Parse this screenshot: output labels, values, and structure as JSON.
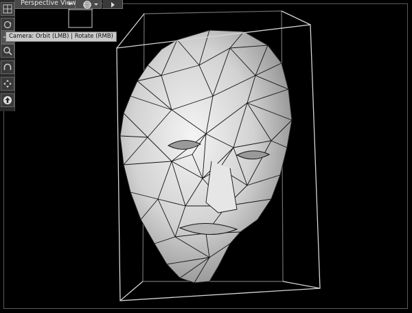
{
  "viewport": {
    "view_mode_label": "Perspective View",
    "tooltip_text": "Camera: Orbit (LMB) | Rotate (RMB)",
    "background_color": "#000000",
    "mesh_color": "#d9d9d9",
    "wire_color": "#111111"
  },
  "toolbar": {
    "tools": [
      {
        "name": "view-grid-icon"
      },
      {
        "name": "camera-orbit-icon"
      },
      {
        "name": "camera-translate-icon"
      },
      {
        "name": "zoom-icon"
      },
      {
        "name": "camera-rotate-icon"
      },
      {
        "name": "pan-arrows-icon"
      },
      {
        "name": "up-arrow-icon"
      }
    ]
  },
  "top_bar": {
    "shading_icon": "sphere-shading-icon",
    "play_icon": "play-icon"
  }
}
